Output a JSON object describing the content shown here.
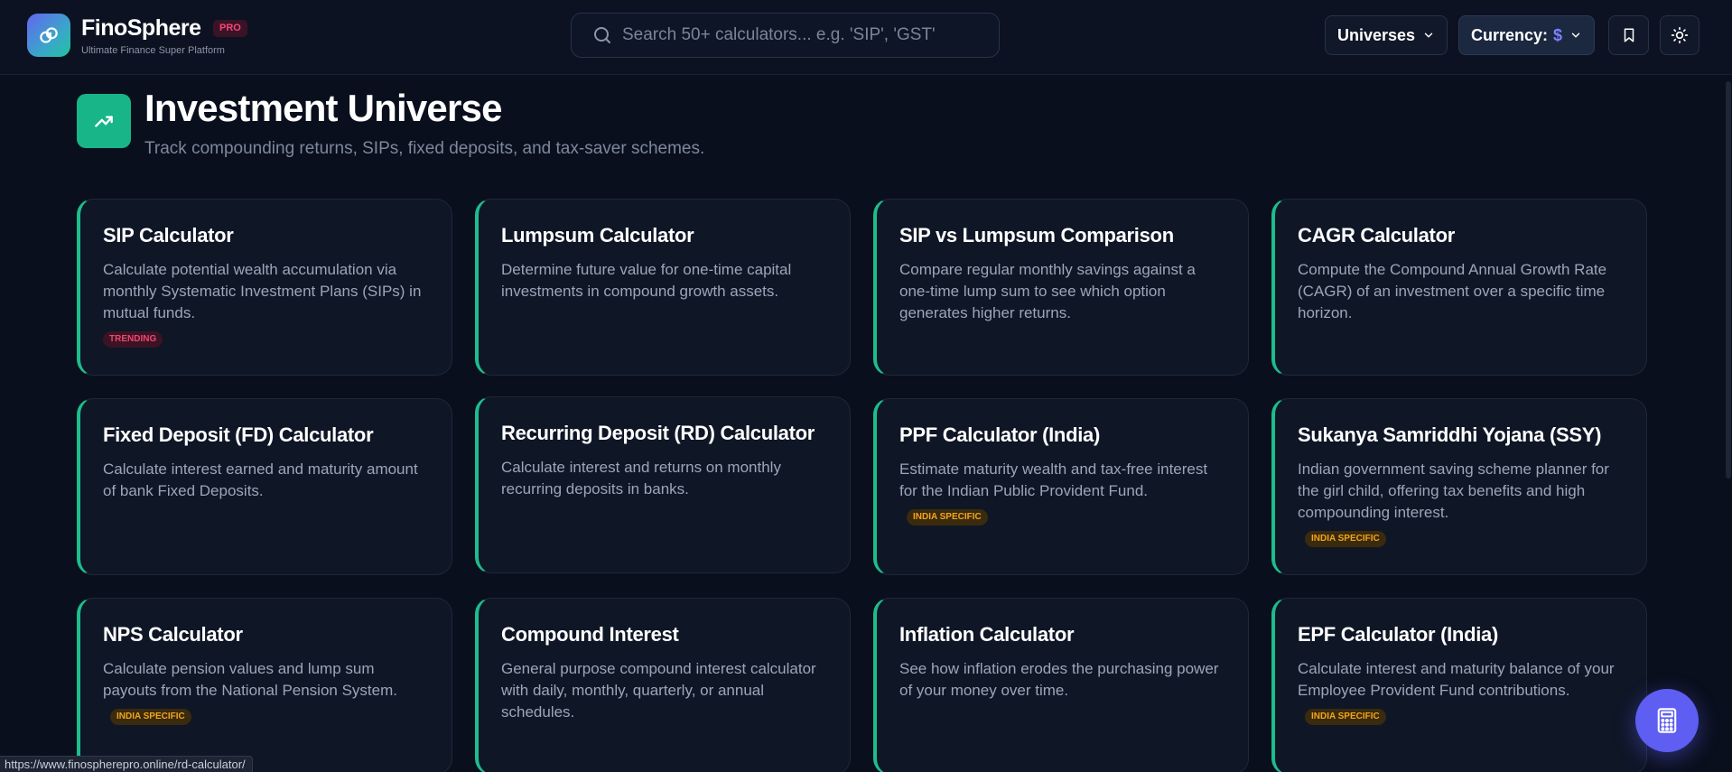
{
  "header": {
    "brand_name": "FinoSphere",
    "pro_label": "PRO",
    "tagline": "Ultimate Finance Super Platform",
    "search_placeholder": "Search 50+ calculators... e.g. 'SIP', 'GST'",
    "universes_label": "Universes",
    "currency_label": "Currency:",
    "currency_symbol": "$"
  },
  "section": {
    "title": "Investment Universe",
    "subtitle": "Track compounding returns, SIPs, fixed deposits, and tax-saver schemes."
  },
  "cards": [
    {
      "title": "SIP Calculator",
      "desc": "Calculate potential wealth accumulation via monthly Systematic Investment Plans (SIPs) in mutual funds.",
      "badge": "TRENDING",
      "badge_type": "trending"
    },
    {
      "title": "Lumpsum Calculator",
      "desc": "Determine future value for one-time capital investments in compound growth assets.",
      "badge": "",
      "badge_type": ""
    },
    {
      "title": "SIP vs Lumpsum Comparison",
      "desc": "Compare regular monthly savings against a one-time lump sum to see which option generates higher returns.",
      "badge": "",
      "badge_type": ""
    },
    {
      "title": "CAGR Calculator",
      "desc": "Compute the Compound Annual Growth Rate (CAGR) of an investment over a specific time horizon.",
      "badge": "",
      "badge_type": ""
    },
    {
      "title": "Fixed Deposit (FD) Calculator",
      "desc": "Calculate interest earned and maturity amount of bank Fixed Deposits.",
      "badge": "",
      "badge_type": ""
    },
    {
      "title": "Recurring Deposit (RD) Calculator",
      "desc": "Calculate interest and returns on monthly recurring deposits in banks.",
      "badge": "",
      "badge_type": ""
    },
    {
      "title": "PPF Calculator (India)",
      "desc": "Estimate maturity wealth and tax-free interest for the Indian Public Provident Fund.",
      "badge": "INDIA SPECIFIC",
      "badge_type": "india"
    },
    {
      "title": "Sukanya Samriddhi Yojana (SSY)",
      "desc": "Indian government saving scheme planner for the girl child, offering tax benefits and high compounding interest.",
      "badge": "INDIA SPECIFIC",
      "badge_type": "india"
    },
    {
      "title": "NPS Calculator",
      "desc": "Calculate pension values and lump sum payouts from the National Pension System.",
      "badge": "INDIA SPECIFIC",
      "badge_type": "india"
    },
    {
      "title": "Compound Interest",
      "desc": "General purpose compound interest calculator with daily, monthly, quarterly, or annual schedules.",
      "badge": "",
      "badge_type": ""
    },
    {
      "title": "Inflation Calculator",
      "desc": "See how inflation erodes the purchasing power of your money over time.",
      "badge": "",
      "badge_type": ""
    },
    {
      "title": "EPF Calculator (India)",
      "desc": "Calculate interest and maturity balance of your Employee Provident Fund contributions.",
      "badge": "INDIA SPECIFIC",
      "badge_type": "india"
    }
  ],
  "status_url": "https://www.finospherepro.online/rd-calculator/",
  "colors": {
    "background": "#0a0f1d",
    "card_accent": "#1dbd8c",
    "section_icon": "#17b588",
    "fab": "#5e5ef2",
    "trending_badge": "#f0466f",
    "india_badge": "#f1a51b"
  },
  "icons": {
    "logo": "link-coins-icon",
    "section": "trending-up-icon",
    "search": "search-icon",
    "bookmark": "bookmark-icon",
    "theme": "sun-icon",
    "fab": "calculator-icon"
  }
}
